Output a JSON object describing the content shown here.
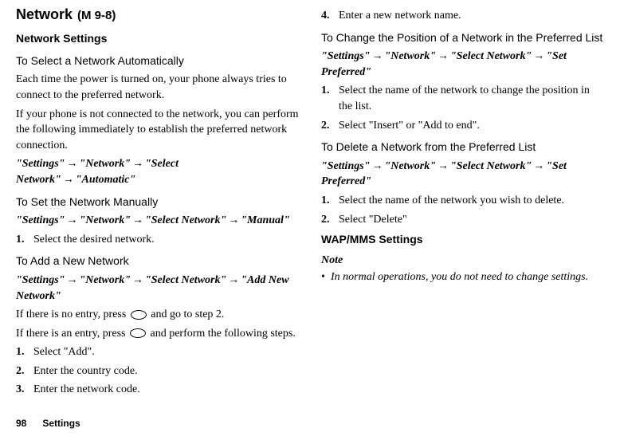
{
  "header": {
    "title": "Network",
    "menu_code": "(M 9-8)"
  },
  "left": {
    "subsection": "Network Settings",
    "auto": {
      "heading": "To Select a Network Automatically",
      "p1": "Each time the power is turned on, your phone always tries to connect to the preferred network.",
      "p2": "If your phone is not connected to the network, you can perform the following immediately to establish the preferred network connection.",
      "path": {
        "s1": "\"Settings\"",
        "s2": "\"Network\"",
        "s3": "\"Select Network\"",
        "s4": "\"Automatic\""
      }
    },
    "manual": {
      "heading": "To Set the Network Manually",
      "path": {
        "s1": "\"Settings\"",
        "s2": "\"Network\"",
        "s3": "\"Select Network\"",
        "s4": "\"Manual\""
      },
      "step1_num": "1.",
      "step1_text": "Select the desired network."
    },
    "add": {
      "heading": "To Add a New Network",
      "path": {
        "s1": "\"Settings\"",
        "s2": "\"Network\"",
        "s3": "\"Select Network\"",
        "s4": "\"Add New Network\""
      },
      "noentry_a": "If there is no entry, press ",
      "noentry_b": " and go to step 2.",
      "entry_a": "If there is an entry, press ",
      "entry_b": " and perform the following steps.",
      "steps": [
        {
          "num": "1.",
          "text": "Select \"Add\"."
        },
        {
          "num": "2.",
          "text": "Enter the country code."
        },
        {
          "num": "3.",
          "text": "Enter the network code."
        }
      ]
    }
  },
  "right": {
    "step4_num": "4.",
    "step4_text": "Enter a new network name.",
    "change": {
      "heading": "To Change the Position of a Network in the Preferred List",
      "path": {
        "s1": "\"Settings\"",
        "s2": "\"Network\"",
        "s3": "\"Select Network\"",
        "s4": "\"Set Preferred\""
      },
      "steps": [
        {
          "num": "1.",
          "text": "Select the name of the network to change the position in the list."
        },
        {
          "num": "2.",
          "text": "Select \"Insert\" or \"Add to end\"."
        }
      ]
    },
    "delete": {
      "heading": "To Delete a Network from the Preferred List",
      "path": {
        "s1": "\"Settings\"",
        "s2": "\"Network\"",
        "s3": "\"Select Network\"",
        "s4": "\"Set Preferred\""
      },
      "steps": [
        {
          "num": "1.",
          "text": "Select the name of the network you wish to delete."
        },
        {
          "num": "2.",
          "text": "Select \"Delete\""
        }
      ]
    },
    "wap": {
      "title": "WAP/MMS Settings",
      "note_label": "Note",
      "note_bullet": "•",
      "note_text": "In normal operations, you do not need to change settings."
    }
  },
  "footer": {
    "page": "98",
    "label": "Settings"
  },
  "arrow": "→"
}
